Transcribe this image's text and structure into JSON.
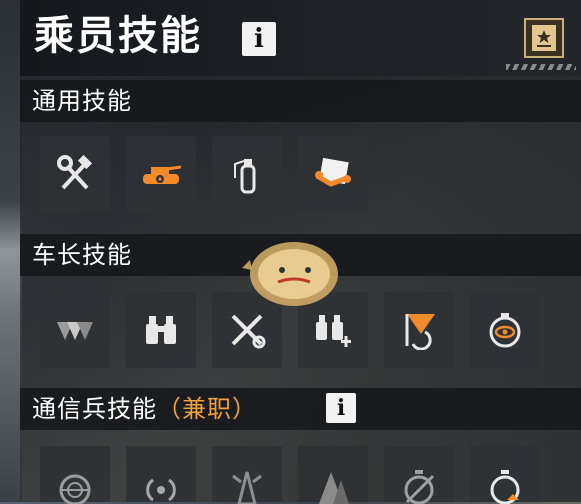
{
  "header": {
    "title": "乘员技能",
    "info_label": "i"
  },
  "sections": [
    {
      "title": "通用技能",
      "suffix": "",
      "skills": [
        {
          "icon": "hammer-wrench-icon"
        },
        {
          "icon": "tank-target-icon"
        },
        {
          "icon": "fire-extinguisher-icon"
        },
        {
          "icon": "repair-kit-icon"
        }
      ]
    },
    {
      "title": "车长技能",
      "suffix": "",
      "skills": [
        {
          "icon": "triangles-icon"
        },
        {
          "icon": "binoculars-icon"
        },
        {
          "icon": "crossed-tools-icon"
        },
        {
          "icon": "binoculars-plus-icon"
        },
        {
          "icon": "flag-rotate-icon"
        },
        {
          "icon": "stopwatch-eye-icon"
        }
      ]
    },
    {
      "title": "通信兵技能",
      "suffix": "（兼职）",
      "info_label": "i",
      "skills": [
        {
          "icon": "radar-icon"
        },
        {
          "icon": "radio-signal-icon"
        },
        {
          "icon": "radio-tower-icon"
        },
        {
          "icon": "trees-icon"
        },
        {
          "icon": "stopwatch-slash-icon"
        },
        {
          "icon": "stopwatch-up-icon"
        }
      ]
    }
  ],
  "colors": {
    "accent": "#f0a040",
    "orange": "#f08a2a",
    "icon": "#e8e8e8"
  }
}
